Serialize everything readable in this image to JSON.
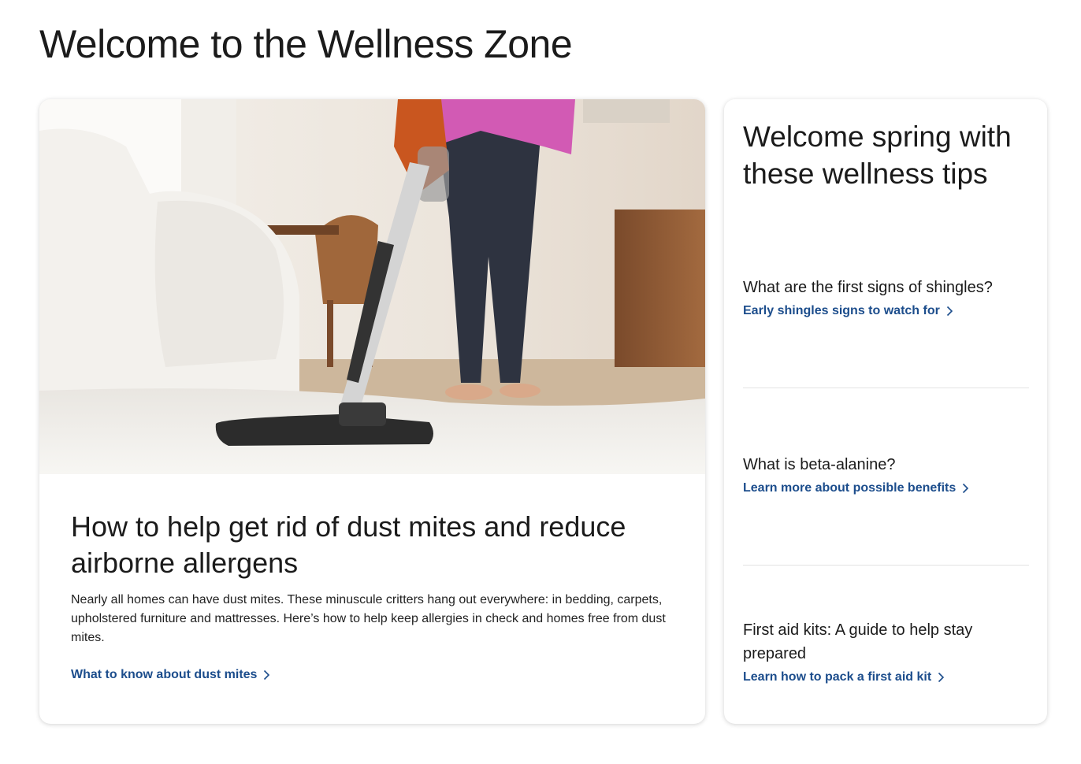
{
  "page": {
    "title": "Welcome to the Wellness Zone"
  },
  "feature": {
    "image_alt": "Person vacuuming a white shag rug in a living room",
    "title": "How to help get rid of dust mites and reduce airborne allergens",
    "description": "Nearly all homes can have dust mites. These minuscule critters hang out everywhere: in bedding, carpets, upholstered furniture and mattresses. Here’s how to help keep allergies in check and homes free from dust mites.",
    "link_label": "What to know about dust mites"
  },
  "sidebar": {
    "title": "Welcome spring with these wellness tips",
    "tips": [
      {
        "question": "What are the first signs of shingles?",
        "link_label": "Early shingles signs to watch for"
      },
      {
        "question": "What is beta-alanine?",
        "link_label": "Learn more about possible benefits"
      },
      {
        "question": "First aid kits: A guide to help stay prepared",
        "link_label": "Learn how to pack a first aid kit"
      }
    ]
  },
  "colors": {
    "link": "#1c4d8c",
    "text": "#1b1b1b",
    "divider": "#e3e3e3"
  },
  "icons": {
    "link_arrow": "chevron-right-icon"
  }
}
